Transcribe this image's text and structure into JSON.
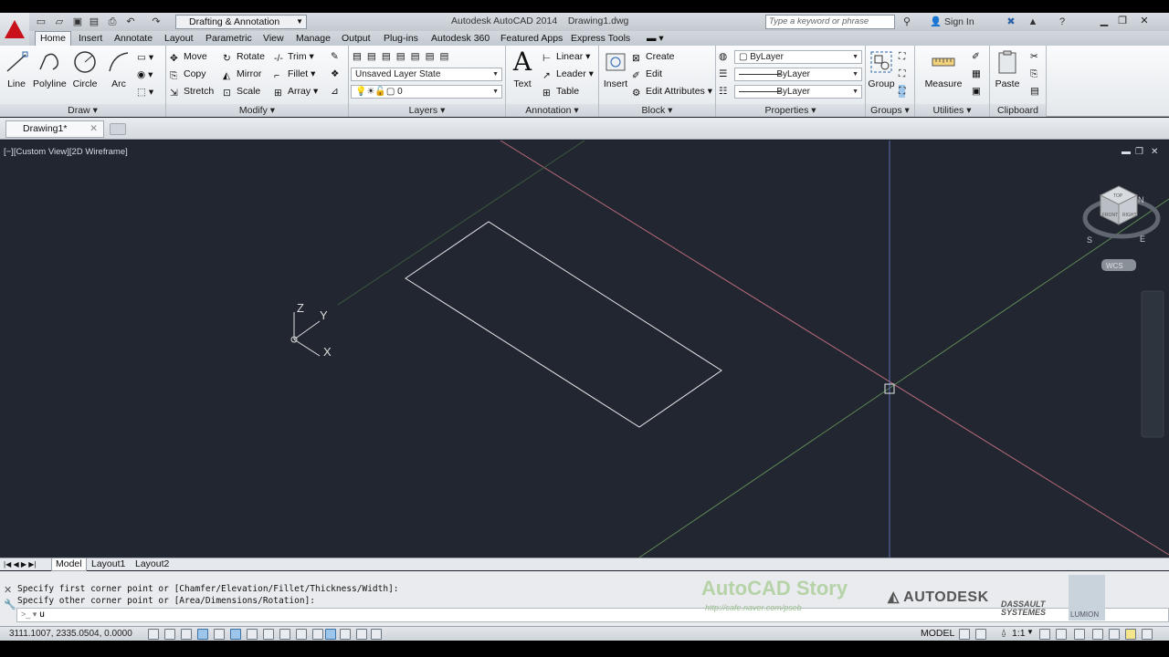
{
  "app": {
    "title": "Autodesk AutoCAD 2014",
    "file": "Drawing1.dwg",
    "workspace": "Drafting & Annotation",
    "search_placeholder": "Type a keyword or phrase",
    "signin": "Sign In"
  },
  "tabs": [
    "Home",
    "Insert",
    "Annotate",
    "Layout",
    "Parametric",
    "View",
    "Manage",
    "Output",
    "Plug-ins",
    "Autodesk 360",
    "Featured Apps",
    "Express Tools"
  ],
  "ribbon": {
    "draw": {
      "title": "Draw",
      "line": "Line",
      "polyline": "Polyline",
      "circle": "Circle",
      "arc": "Arc"
    },
    "modify": {
      "title": "Modify",
      "move": "Move",
      "rotate": "Rotate",
      "trim": "Trim",
      "copy": "Copy",
      "mirror": "Mirror",
      "fillet": "Fillet",
      "stretch": "Stretch",
      "scale": "Scale",
      "array": "Array"
    },
    "layers": {
      "title": "Layers",
      "state": "Unsaved Layer State",
      "layer": "0"
    },
    "annotation": {
      "title": "Annotation",
      "text": "Text",
      "linear": "Linear",
      "leader": "Leader",
      "table": "Table"
    },
    "block": {
      "title": "Block",
      "insert": "Insert",
      "create": "Create",
      "edit": "Edit",
      "edit_attributes": "Edit Attributes"
    },
    "properties": {
      "title": "Properties",
      "color": "ByLayer",
      "linetype": "ByLayer",
      "lineweight": "ByLayer"
    },
    "groups": {
      "title": "Groups",
      "group": "Group"
    },
    "utilities": {
      "title": "Utilities",
      "measure": "Measure"
    },
    "clipboard": {
      "title": "Clipboard",
      "paste": "Paste"
    }
  },
  "doc_tab": "Drawing1*",
  "viewport": {
    "label": "[−][Custom View][2D Wireframe]",
    "ucs_z": "Z",
    "ucs_y": "Y",
    "ucs_x": "X",
    "wcs": "WCS",
    "compass_s": "S",
    "compass_e": "E",
    "compass_n": "N",
    "cube_top": "TOP",
    "cube_front": "FRONT",
    "cube_right": "RIGHT"
  },
  "layout_tabs": [
    "Model",
    "Layout1",
    "Layout2"
  ],
  "command": {
    "line1": "Specify first corner point or [Chamfer/Elevation/Fillet/Thickness/Width]:",
    "line2": "Specify other corner point or [Area/Dimensions/Rotation]:",
    "input": "u"
  },
  "watermark": {
    "story": "AutoCAD Story",
    "url": "http://cafe.naver.com/pseb",
    "autodesk": "AUTODESK",
    "dassault1": "DASSAULT",
    "dassault2": "SYSTEMES",
    "lumion": "LUMION"
  },
  "status": {
    "coords": "3111.1007, 2335.0504, 0.0000",
    "model": "MODEL",
    "scale": "1:1"
  },
  "colors": {
    "accent": "#c8111a",
    "viewport_bg": "#212630",
    "axis_red": "#b86a7a",
    "axis_green": "#5f8a55",
    "axis_blue": "#5a6fb0"
  }
}
